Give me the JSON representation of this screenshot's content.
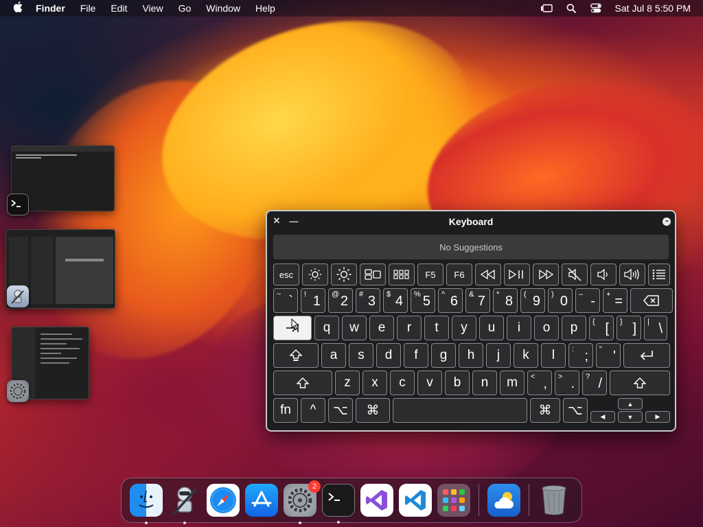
{
  "menubar": {
    "app_name": "Finder",
    "menus": [
      "File",
      "Edit",
      "View",
      "Go",
      "Window",
      "Help"
    ],
    "datetime": "Sat Jul 8  5:50 PM"
  },
  "keyboard": {
    "title": "Keyboard",
    "suggestions": "No Suggestions",
    "fn_row": [
      "esc",
      "F5",
      "F6"
    ],
    "number_row": [
      {
        "shift": "~",
        "main": "`"
      },
      {
        "shift": "!",
        "main": "1"
      },
      {
        "shift": "@",
        "main": "2"
      },
      {
        "shift": "#",
        "main": "3"
      },
      {
        "shift": "$",
        "main": "4"
      },
      {
        "shift": "%",
        "main": "5"
      },
      {
        "shift": "^",
        "main": "6"
      },
      {
        "shift": "&",
        "main": "7"
      },
      {
        "shift": "*",
        "main": "8"
      },
      {
        "shift": "(",
        "main": "9"
      },
      {
        "shift": ")",
        "main": "0"
      },
      {
        "shift": "–",
        "main": "-"
      },
      {
        "shift": "+",
        "main": "="
      }
    ],
    "qwerty_row": [
      "q",
      "w",
      "e",
      "r",
      "t",
      "y",
      "u",
      "i",
      "o",
      "p"
    ],
    "qwerty_symbols": [
      {
        "shift": "{",
        "main": "["
      },
      {
        "shift": "}",
        "main": "]"
      },
      {
        "shift": "|",
        "main": "\\"
      }
    ],
    "home_row": [
      "a",
      "s",
      "d",
      "f",
      "g",
      "h",
      "j",
      "k",
      "l"
    ],
    "home_symbols": [
      {
        "shift": ":",
        "main": ";"
      },
      {
        "shift": "\"",
        "main": "'"
      }
    ],
    "bottom_row": [
      "z",
      "x",
      "c",
      "v",
      "b",
      "n",
      "m"
    ],
    "bottom_symbols": [
      {
        "shift": "<",
        "main": ","
      },
      {
        "shift": ">",
        "main": "."
      },
      {
        "shift": "?",
        "main": "/"
      }
    ],
    "modifiers": {
      "fn": "fn",
      "control": "^",
      "option": "⌥",
      "command": "⌘"
    }
  },
  "dock": {
    "settings_badge": "2"
  },
  "colors": {
    "key_background": "#2c2c2e",
    "key_border": "#8c8c90",
    "active_key": "#f2f2f2",
    "badge": "#ff3b30"
  }
}
